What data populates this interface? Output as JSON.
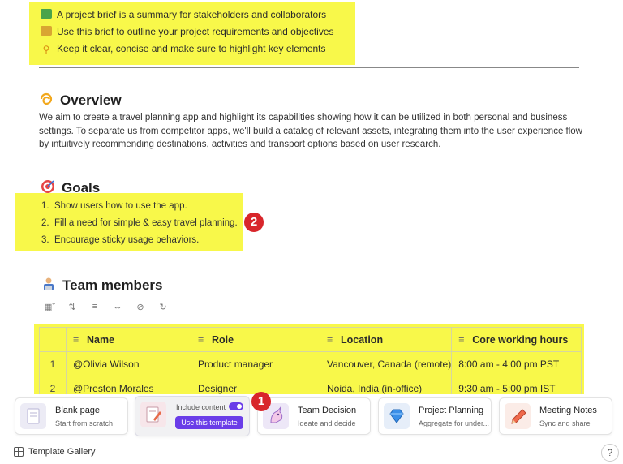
{
  "intro": {
    "lines": [
      "A project brief is a summary for stakeholders and collaborators",
      "Use this brief to outline your project requirements and objectives",
      "Keep it clear, concise and make sure to highlight key elements"
    ],
    "icons": [
      "green-book-icon",
      "notepad-icon",
      "key-icon"
    ]
  },
  "overview": {
    "title": "Overview",
    "icon": "dizzy-icon",
    "text": "We aim to create a travel planning app and highlight its capabilities showing how it can be utilized in both personal and business settings. To separate us from competitor apps, we'll build a catalog of relevant assets, integrating them into the user experience flow by intuitively recommending destinations, activities and transport options based on user research."
  },
  "goals": {
    "title": "Goals",
    "icon": "target-icon",
    "items": [
      {
        "num": "1.",
        "text": "Show users how to use the app."
      },
      {
        "num": "2.",
        "text": "Fill a need for simple & easy travel planning."
      },
      {
        "num": "3.",
        "text": "Encourage sticky usage behaviors."
      }
    ]
  },
  "team": {
    "title": "Team members",
    "icon": "technologist-icon",
    "toolbar_icons": [
      "table-view-icon",
      "sort-icon",
      "filter-icon",
      "resize-icon",
      "hide-icon",
      "more-icon"
    ],
    "columns": [
      "Name",
      "Role",
      "Location",
      "Core working hours"
    ],
    "rows": [
      {
        "num": "1",
        "name": "@Olivia Wilson",
        "role": "Product manager",
        "location": "Vancouver, Canada (remote)",
        "hours": "8:00 am - 4:00 pm PST"
      },
      {
        "num": "2",
        "name": "@Preston Morales",
        "role": "Designer",
        "location": "Noida, India (in-office)",
        "hours": "9:30 am - 5:00 pm IST"
      }
    ]
  },
  "badges": {
    "one": "1",
    "two": "2"
  },
  "templates": {
    "blank": {
      "title": "Blank page",
      "subtitle": "Start from scratch"
    },
    "active": {
      "include_label": "Include content",
      "button": "Use this template"
    },
    "team_decision": {
      "title": "Team Decision",
      "subtitle": "Ideate and decide"
    },
    "project_planning": {
      "title": "Project Planning",
      "subtitle": "Aggregate for under..."
    },
    "meeting_notes": {
      "title": "Meeting Notes",
      "subtitle": "Sync and share"
    },
    "gallery_label": "Template Gallery",
    "help": "?"
  },
  "colors": {
    "highlight": "#f8f84a",
    "accent": "#6a3de8",
    "badge": "#d8262b"
  }
}
